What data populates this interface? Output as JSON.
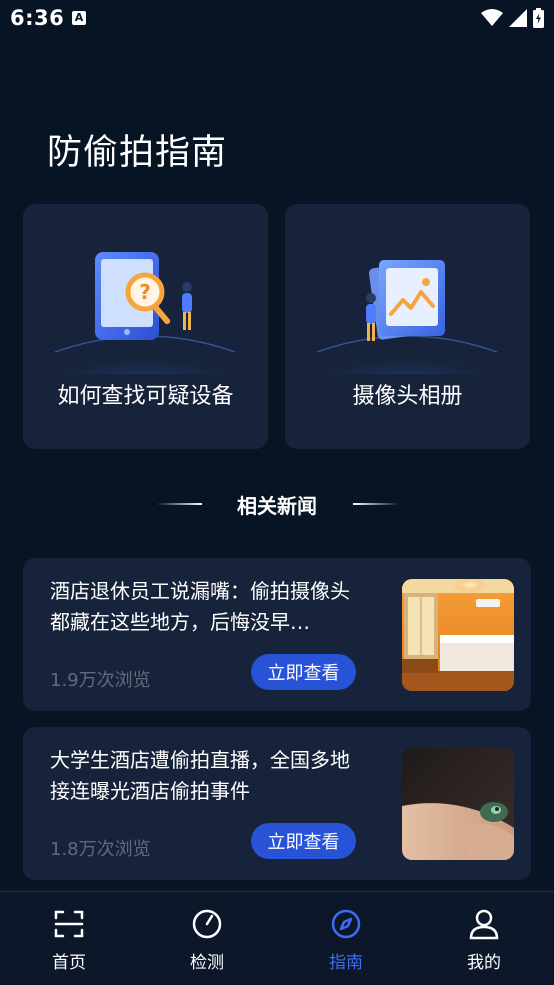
{
  "status": {
    "time": "6:36",
    "a_badge": "A"
  },
  "page": {
    "title": "防偷拍指南"
  },
  "cards": [
    {
      "label": "如何查找可疑设备",
      "icon": "device-search-illustration"
    },
    {
      "label": "摄像头相册",
      "icon": "photo-album-illustration"
    }
  ],
  "section": {
    "title": "相关新闻"
  },
  "news": [
    {
      "title": "酒店退休员工说漏嘴：偷拍摄像头都藏在这些地方，后悔没早…",
      "views": "1.9万次浏览",
      "button": "立即查看",
      "thumb": "hotel-room-photo"
    },
    {
      "title": "大学生酒店遭偷拍直播，全国多地接连曝光酒店偷拍事件",
      "views": "1.8万次浏览",
      "button": "立即查看",
      "thumb": "hidden-camera-photo"
    }
  ],
  "tabs": [
    {
      "label": "首页",
      "icon": "scan-icon",
      "active": false
    },
    {
      "label": "检测",
      "icon": "gauge-icon",
      "active": false
    },
    {
      "label": "指南",
      "icon": "compass-icon",
      "active": true
    },
    {
      "label": "我的",
      "icon": "user-icon",
      "active": false
    }
  ],
  "colors": {
    "background": "#071424",
    "card": "#16233a",
    "accent": "#2953d7",
    "active_tab": "#3d6df0"
  }
}
